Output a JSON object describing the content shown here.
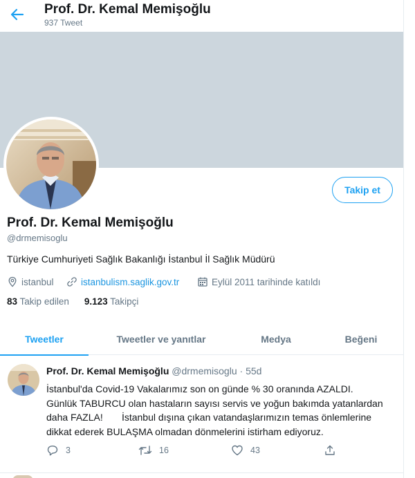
{
  "header": {
    "name": "Prof. Dr. Kemal Memişoğlu",
    "tweet_count": "937 Tweet"
  },
  "profile": {
    "name": "Prof. Dr. Kemal Memişoğlu",
    "handle": "@drmemisoglu",
    "bio": "Türkiye Cumhuriyeti Sağlık Bakanlığı İstanbul İl Sağlık Müdürü",
    "location": "istanbul",
    "website": "istanbulism.saglik.gov.tr",
    "joined": "Eylül 2011 tarihinde katıldı",
    "following_count": "83",
    "following_label": "Takip edilen",
    "followers_count": "9.123",
    "followers_label": "Takipçi",
    "follow_button": "Takip et"
  },
  "tabs": [
    {
      "label": "Tweetler",
      "active": true
    },
    {
      "label": "Tweetler ve yanıtlar",
      "active": false
    },
    {
      "label": "Medya",
      "active": false
    },
    {
      "label": "Beğeni",
      "active": false
    }
  ],
  "tweet": {
    "name": "Prof. Dr. Kemal Memişoğlu",
    "handle": "@drmemisoglu",
    "separator": "·",
    "time": "55d",
    "lines": [
      "İstanbul'da Covid-19 Vakalarımız son on günde % 30 oranında AZALDI.",
      "Günlük TABURCU olan hastaların sayısı servis ve yoğun bakımda yatanlardan",
      "daha FAZLA!       İstanbul dışına çıkan vatandaşlarımızın temas önlemlerine",
      "dikkat ederek BULAŞMA olmadan dönmelerini istirham ediyoruz."
    ],
    "replies": "3",
    "retweets": "16",
    "likes": "43"
  },
  "colors": {
    "accent": "#1da1f2",
    "link": "#1b95e0",
    "secondary_text": "#657786",
    "banner": "#ccd6dd"
  },
  "icons": [
    "back-arrow-icon",
    "location-icon",
    "link-icon",
    "calendar-icon",
    "reply-icon",
    "retweet-icon",
    "like-icon",
    "share-icon"
  ]
}
